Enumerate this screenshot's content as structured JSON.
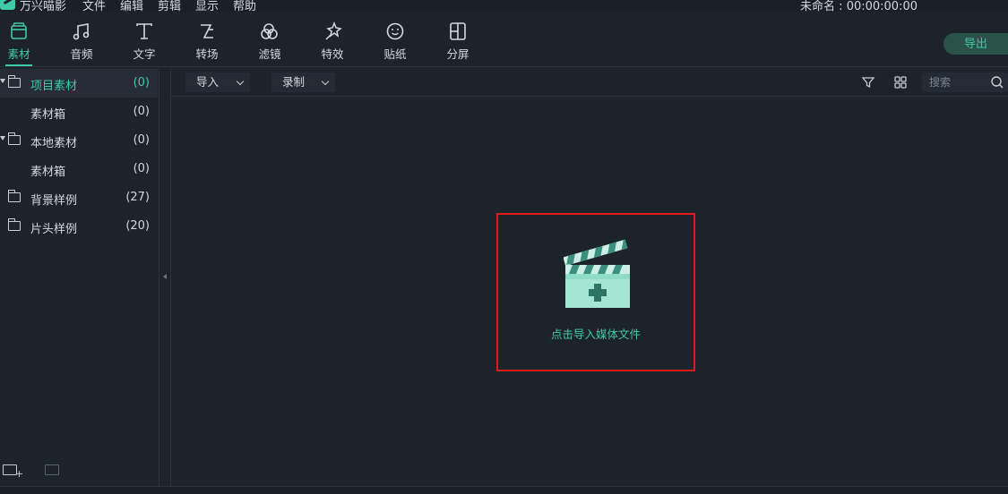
{
  "menubar": {
    "app_name": "万兴喵影",
    "items": [
      "文件",
      "编辑",
      "剪辑",
      "显示",
      "帮助"
    ],
    "project_title": "未命名 : 00:00:00:00"
  },
  "toolbar": {
    "tools": [
      {
        "label": "素材",
        "icon": "media-icon",
        "active": true
      },
      {
        "label": "音频",
        "icon": "music-note-icon",
        "active": false
      },
      {
        "label": "文字",
        "icon": "text-icon",
        "active": false
      },
      {
        "label": "转场",
        "icon": "transition-icon",
        "active": false
      },
      {
        "label": "滤镜",
        "icon": "filter-icon",
        "active": false
      },
      {
        "label": "特效",
        "icon": "effects-icon",
        "active": false
      },
      {
        "label": "贴纸",
        "icon": "sticker-icon",
        "active": false
      },
      {
        "label": "分屏",
        "icon": "split-screen-icon",
        "active": false
      }
    ],
    "export_label": "导出"
  },
  "library": {
    "items": [
      {
        "name": "项目素材",
        "count": "(0)",
        "expanded": true,
        "selected": true,
        "level": 0
      },
      {
        "name": "素材箱",
        "count": "(0)",
        "level": 1
      },
      {
        "name": "本地素材",
        "count": "(0)",
        "expanded": true,
        "level": 0
      },
      {
        "name": "素材箱",
        "count": "(0)",
        "level": 1
      },
      {
        "name": "背景样例",
        "count": "(27)",
        "level": 0
      },
      {
        "name": "片头样例",
        "count": "(20)",
        "level": 0
      }
    ]
  },
  "content": {
    "import_label": "导入",
    "record_label": "录制",
    "search_placeholder": "搜索",
    "drop_hint": "点击导入媒体文件"
  },
  "colors": {
    "accent": "#3ec9a7",
    "background": "#1d232b",
    "highlight_border": "#e0191c"
  }
}
